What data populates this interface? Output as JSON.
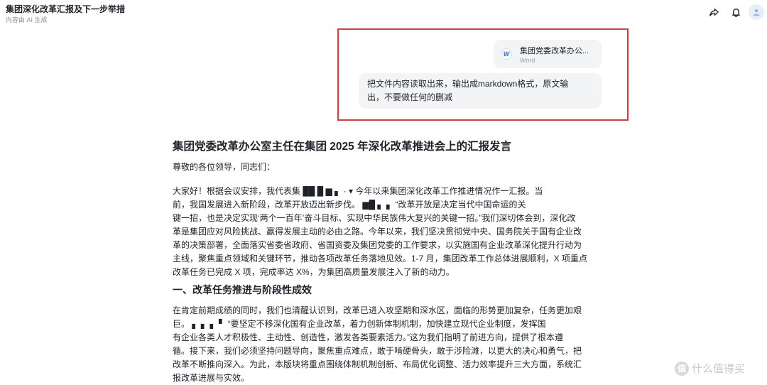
{
  "header": {
    "title": "集团深化改革汇报及下一步举措",
    "subtitle": "内容由 AI 生成"
  },
  "icons": {
    "share": "share-icon",
    "bell": "bell-icon",
    "avatar": "user-icon"
  },
  "chat": {
    "file_name": "集团党委改革办公...",
    "file_type": "Word",
    "file_icon_letter": "W",
    "message_line1": "把文件内容读取出来，输出成markdown格式，原文输",
    "message_line2": "出，不要做任何的删减"
  },
  "document": {
    "title": "集团党委改革办公室主任在集团 2025 年深化改革推进会上的汇报发言",
    "greeting": "尊敬的各位领导，同志们：",
    "para1": [
      "大家好！根据会议安排，我代表集 ██ █ ▆ ▖ ·     ▾ 今年以来集团深化改革工作推进情况作一汇报。当",
      "前，我国发展进入新阶段，改革开放迈出新步伐。 ▆█ ▖ ▖  “改革开放是决定当代中国命运的关",
      "键一招，也是决定实现‘两个一百年’奋斗目标、实现中华民族伟大复兴的关键一招。”我们深切体会到，深化改",
      "革是集团应对风险挑战、赢得发展主动的必由之路。今年以来，我们坚决贯彻党中央、国务院关于国有企业改",
      "革的决策部署，全面落实省委省政府、省国资委及集团党委的工作要求，以实施国有企业改革深化提升行动为",
      "主线，聚焦重点领域和关键环节，推动各项改革任务落地见效。1-7 月，集团改革工作总体进展顺利，X 项重点",
      "改革任务已完成 X 项，完成率达 X%，为集团高质量发展注入了新的动力。"
    ],
    "section1_heading": "一、改革任务推进与阶段性成效",
    "para2": [
      "在肯定前期成绩的同时，我们也清醒认识到，改革已进入攻坚期和深水区，面临的形势更加复杂，任务更加艰",
      "巨。 ▖ ▖ ▖ ▘  “要坚定不移深化国有企业改革，着力创新体制机制，加快建立现代企业制度，发挥国",
      "有企业各类人才积极性、主动性、创造性，激发各类要素活力。”这为我们指明了前进方向，提供了根本遵",
      "循。接下来，我们必须坚持问题导向，聚焦重点难点，敢于啃硬骨头，敢于涉险滩，以更大的决心和勇气，把",
      "改革不断推向深入。为此，本版块将重点围绕体制机制创新、布局优化调整、活力效率提升三大方面，系统汇",
      "报改革进展与实效。"
    ]
  },
  "watermark": {
    "logo": "值",
    "text": "什么值得买"
  },
  "colors": {
    "highlight_border": "#e03a3a",
    "bubble_bg": "#f3f4f6",
    "word_blue": "#2b63d9"
  }
}
